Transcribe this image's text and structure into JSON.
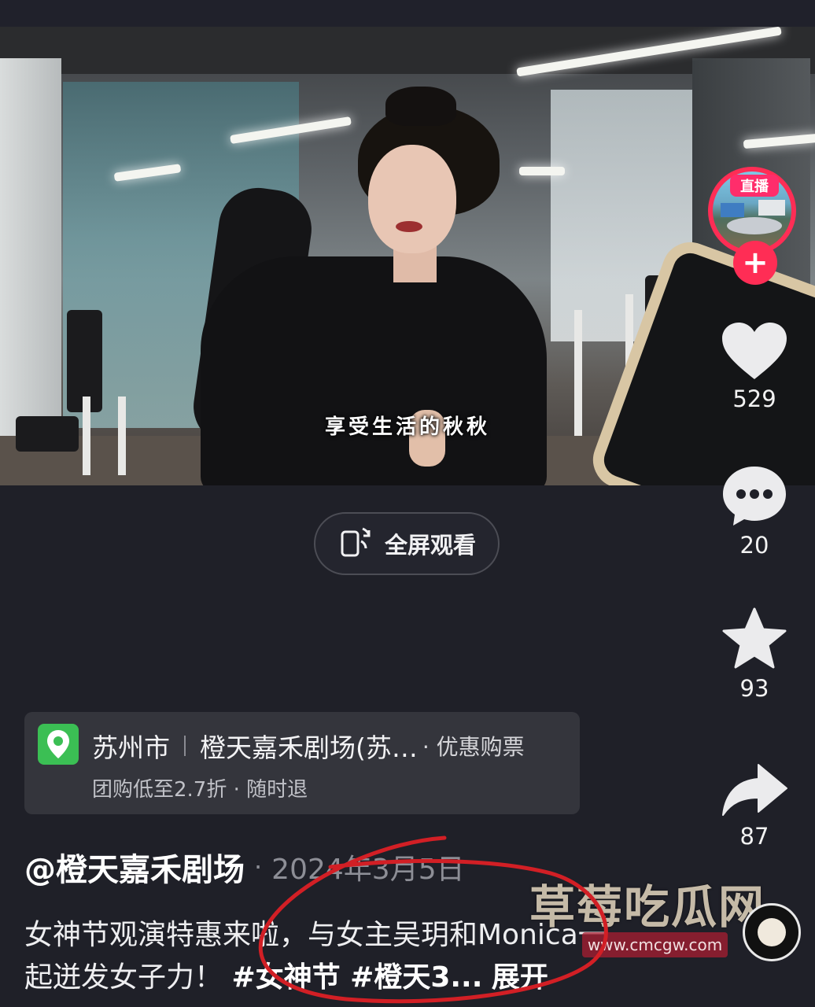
{
  "video": {
    "subtitle": "享受生活的秋秋"
  },
  "fullscreen_button": {
    "label": "全屏观看",
    "icon": "rotate-phone-icon"
  },
  "sidebar": {
    "live_badge": "直播",
    "follow_symbol": "+",
    "likes": "529",
    "comments": "20",
    "favorites": "93",
    "shares": "87"
  },
  "poi": {
    "city": "苏州市",
    "venue": "橙天嘉禾剧场(苏…",
    "deal": "· 优惠购票",
    "sub": "团购低至2.7折 · 随时退"
  },
  "post": {
    "author": "@橙天嘉禾剧场",
    "separator": "·",
    "date": "2024年3月5日",
    "caption_text": "女神节观演特惠来啦，与女主吴玥和Monica一起迸发女子力！",
    "hashtags": "#女神节 #橙天3...",
    "expand": "展开"
  },
  "watermark": {
    "title": "草莓吃瓜网",
    "url": "www.cmcgw.com"
  },
  "colors": {
    "background": "#1f2028",
    "accent": "#ff2d55",
    "poi_green": "#3bbf54",
    "annotation_red": "#d21f25"
  }
}
